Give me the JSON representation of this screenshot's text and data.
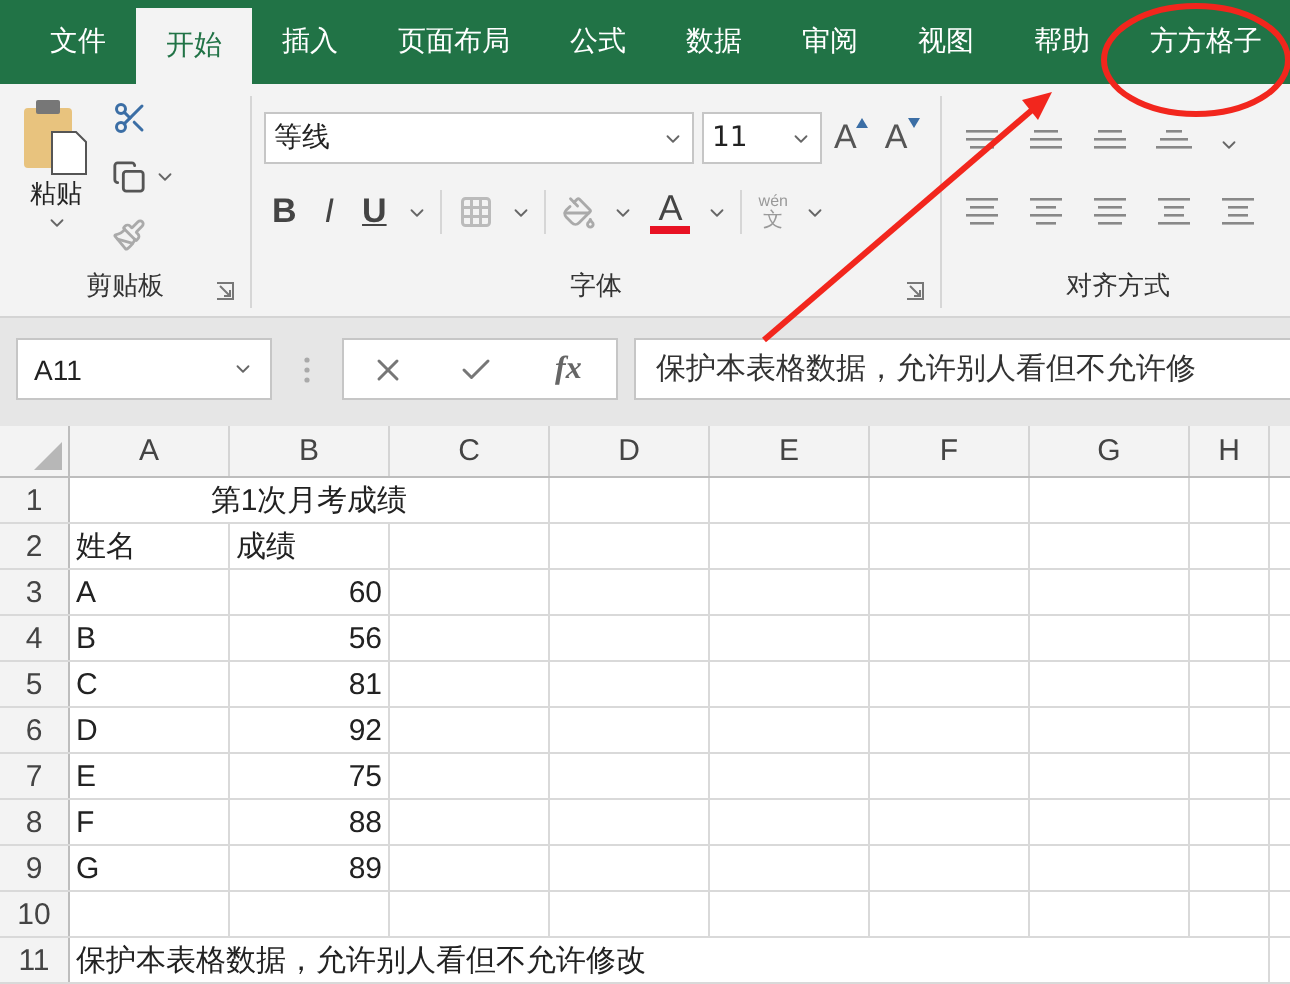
{
  "tabs": [
    {
      "label": "文件",
      "selected": false
    },
    {
      "label": "开始",
      "selected": true
    },
    {
      "label": "插入",
      "selected": false
    },
    {
      "label": "页面布局",
      "selected": false
    },
    {
      "label": "公式",
      "selected": false
    },
    {
      "label": "数据",
      "selected": false
    },
    {
      "label": "审阅",
      "selected": false
    },
    {
      "label": "视图",
      "selected": false
    },
    {
      "label": "帮助",
      "selected": false
    },
    {
      "label": "方方格子",
      "selected": false
    }
  ],
  "ribbon": {
    "clipboard": {
      "paste_label": "粘贴",
      "group_label": "剪贴板"
    },
    "font": {
      "font_name": "等线",
      "font_size": "11",
      "grow_label": "A",
      "shrink_label": "A",
      "bold": "B",
      "italic": "I",
      "underline": "U",
      "font_color_label": "A",
      "phonetic_top": "wén",
      "phonetic_bottom": "文",
      "group_label": "字体"
    },
    "alignment": {
      "group_label": "对齐方式"
    }
  },
  "formula_bar": {
    "name_box": "A11",
    "fx": "fx",
    "value": "保护本表格数据，允许别人看但不允许修"
  },
  "sheet": {
    "columns": [
      "A",
      "B",
      "C",
      "D",
      "E",
      "F",
      "G",
      "H"
    ],
    "rows": [
      {
        "number": "1",
        "cells": [
          {
            "kind": "merged",
            "text": "第1次月考成绩"
          }
        ]
      },
      {
        "number": "2",
        "cells": [
          {
            "kind": "text",
            "text": "姓名"
          },
          {
            "kind": "text",
            "text": "成绩"
          }
        ]
      },
      {
        "number": "3",
        "cells": [
          {
            "kind": "text",
            "text": "A"
          },
          {
            "kind": "number",
            "text": "60"
          }
        ]
      },
      {
        "number": "4",
        "cells": [
          {
            "kind": "text",
            "text": "B"
          },
          {
            "kind": "number",
            "text": "56"
          }
        ]
      },
      {
        "number": "5",
        "cells": [
          {
            "kind": "text",
            "text": "C"
          },
          {
            "kind": "number",
            "text": "81"
          }
        ]
      },
      {
        "number": "6",
        "cells": [
          {
            "kind": "text",
            "text": "D"
          },
          {
            "kind": "number",
            "text": "92"
          }
        ]
      },
      {
        "number": "7",
        "cells": [
          {
            "kind": "text",
            "text": "E"
          },
          {
            "kind": "number",
            "text": "75"
          }
        ]
      },
      {
        "number": "8",
        "cells": [
          {
            "kind": "text",
            "text": "F"
          },
          {
            "kind": "number",
            "text": "88"
          }
        ]
      },
      {
        "number": "9",
        "cells": [
          {
            "kind": "text",
            "text": "G"
          },
          {
            "kind": "number",
            "text": "89"
          }
        ]
      },
      {
        "number": "10",
        "cells": []
      },
      {
        "number": "11",
        "cells": [
          {
            "kind": "overflow",
            "text": "保护本表格数据，允许别人看但不允许修改"
          }
        ]
      }
    ]
  },
  "annotations": {
    "arrow": true,
    "ellipse": true
  }
}
